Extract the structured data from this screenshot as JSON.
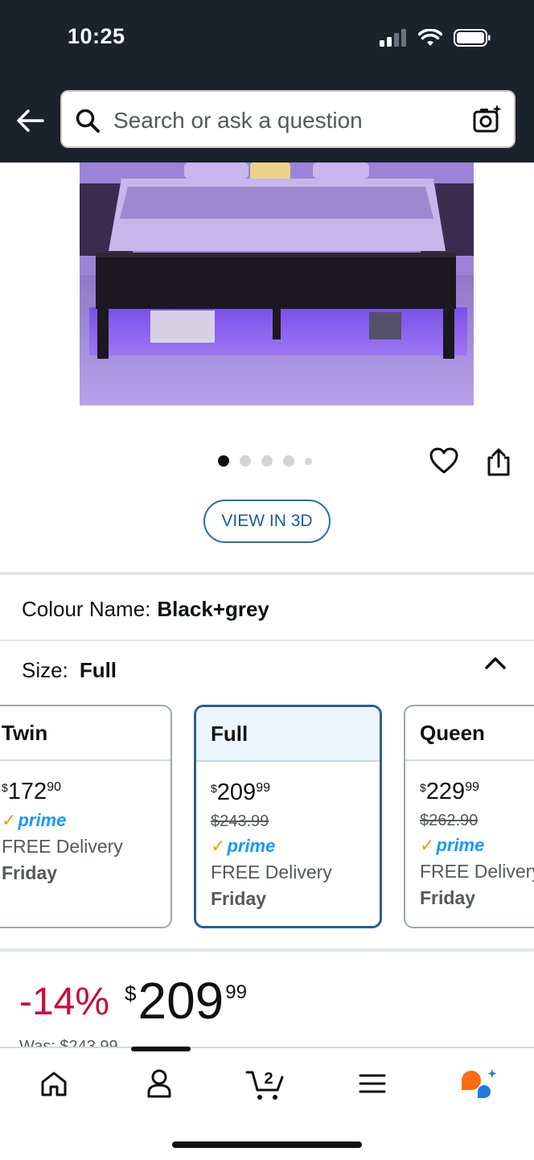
{
  "status_bar": {
    "time": "10:25"
  },
  "search": {
    "placeholder": "Search or ask a question"
  },
  "gallery": {
    "dot_count": 5,
    "active_index": 0
  },
  "actions": {
    "view_3d_label": "VIEW IN 3D"
  },
  "colour": {
    "label": "Colour Name:",
    "value": "Black+grey"
  },
  "size": {
    "label": "Size:",
    "value": "Full",
    "options": [
      {
        "name": "Twin",
        "price_whole": "172",
        "price_cents": "90",
        "was": "",
        "prime": "prime",
        "delivery": "FREE Delivery",
        "day": "Friday",
        "selected": false
      },
      {
        "name": "Full",
        "price_whole": "209",
        "price_cents": "99",
        "was": "$243.99",
        "prime": "prime",
        "delivery": "FREE Delivery",
        "day": "Friday",
        "selected": true
      },
      {
        "name": "Queen",
        "price_whole": "229",
        "price_cents": "99",
        "was": "$262.90",
        "prime": "prime",
        "delivery": "FREE Delivery",
        "day": "Friday",
        "selected": false
      }
    ]
  },
  "price": {
    "discount": "-14%",
    "currency": "$",
    "whole": "209",
    "cents": "99",
    "was": "Was: $243.99"
  },
  "bottom_nav": {
    "cart_count": "2",
    "items": [
      "home-icon",
      "account-icon",
      "cart-icon",
      "menu-icon",
      "rufus-ai-icon"
    ]
  },
  "colors": {
    "top_bar": "#1b222b",
    "prime_blue": "#1399ff",
    "discount_red": "#cc0c39",
    "selected_border": "#2b5f8f"
  }
}
